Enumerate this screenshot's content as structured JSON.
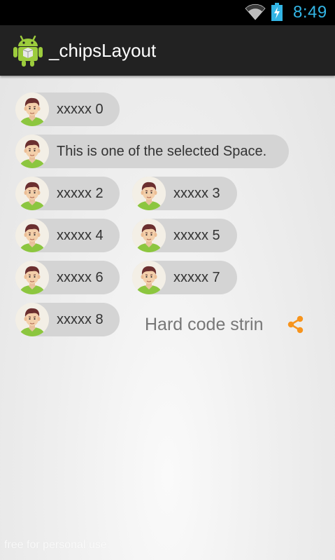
{
  "status_bar": {
    "time": "8:49",
    "icons": [
      "wifi-icon",
      "battery-charging-icon"
    ],
    "time_color": "#33b5e5"
  },
  "action_bar": {
    "title": "_chipsLayout",
    "icon": "android-app-icon"
  },
  "chips": [
    {
      "label": "xxxxx 0",
      "avatar": "avatar-icon"
    },
    {
      "label": "This is one of the selected Space.",
      "avatar": "avatar-icon"
    },
    {
      "label": "xxxxx 2",
      "avatar": "avatar-icon"
    },
    {
      "label": "xxxxx 3",
      "avatar": "avatar-icon"
    },
    {
      "label": "xxxxx 4",
      "avatar": "avatar-icon"
    },
    {
      "label": "xxxxx 5",
      "avatar": "avatar-icon"
    },
    {
      "label": "xxxxx 6",
      "avatar": "avatar-icon"
    },
    {
      "label": "xxxxx 7",
      "avatar": "avatar-icon"
    },
    {
      "label": "xxxxx 8",
      "avatar": "avatar-icon"
    }
  ],
  "hardcode": {
    "label": "Hard code strin",
    "icon": "share-icon",
    "icon_color": "#f7941d"
  },
  "watermark": "free for personal use"
}
